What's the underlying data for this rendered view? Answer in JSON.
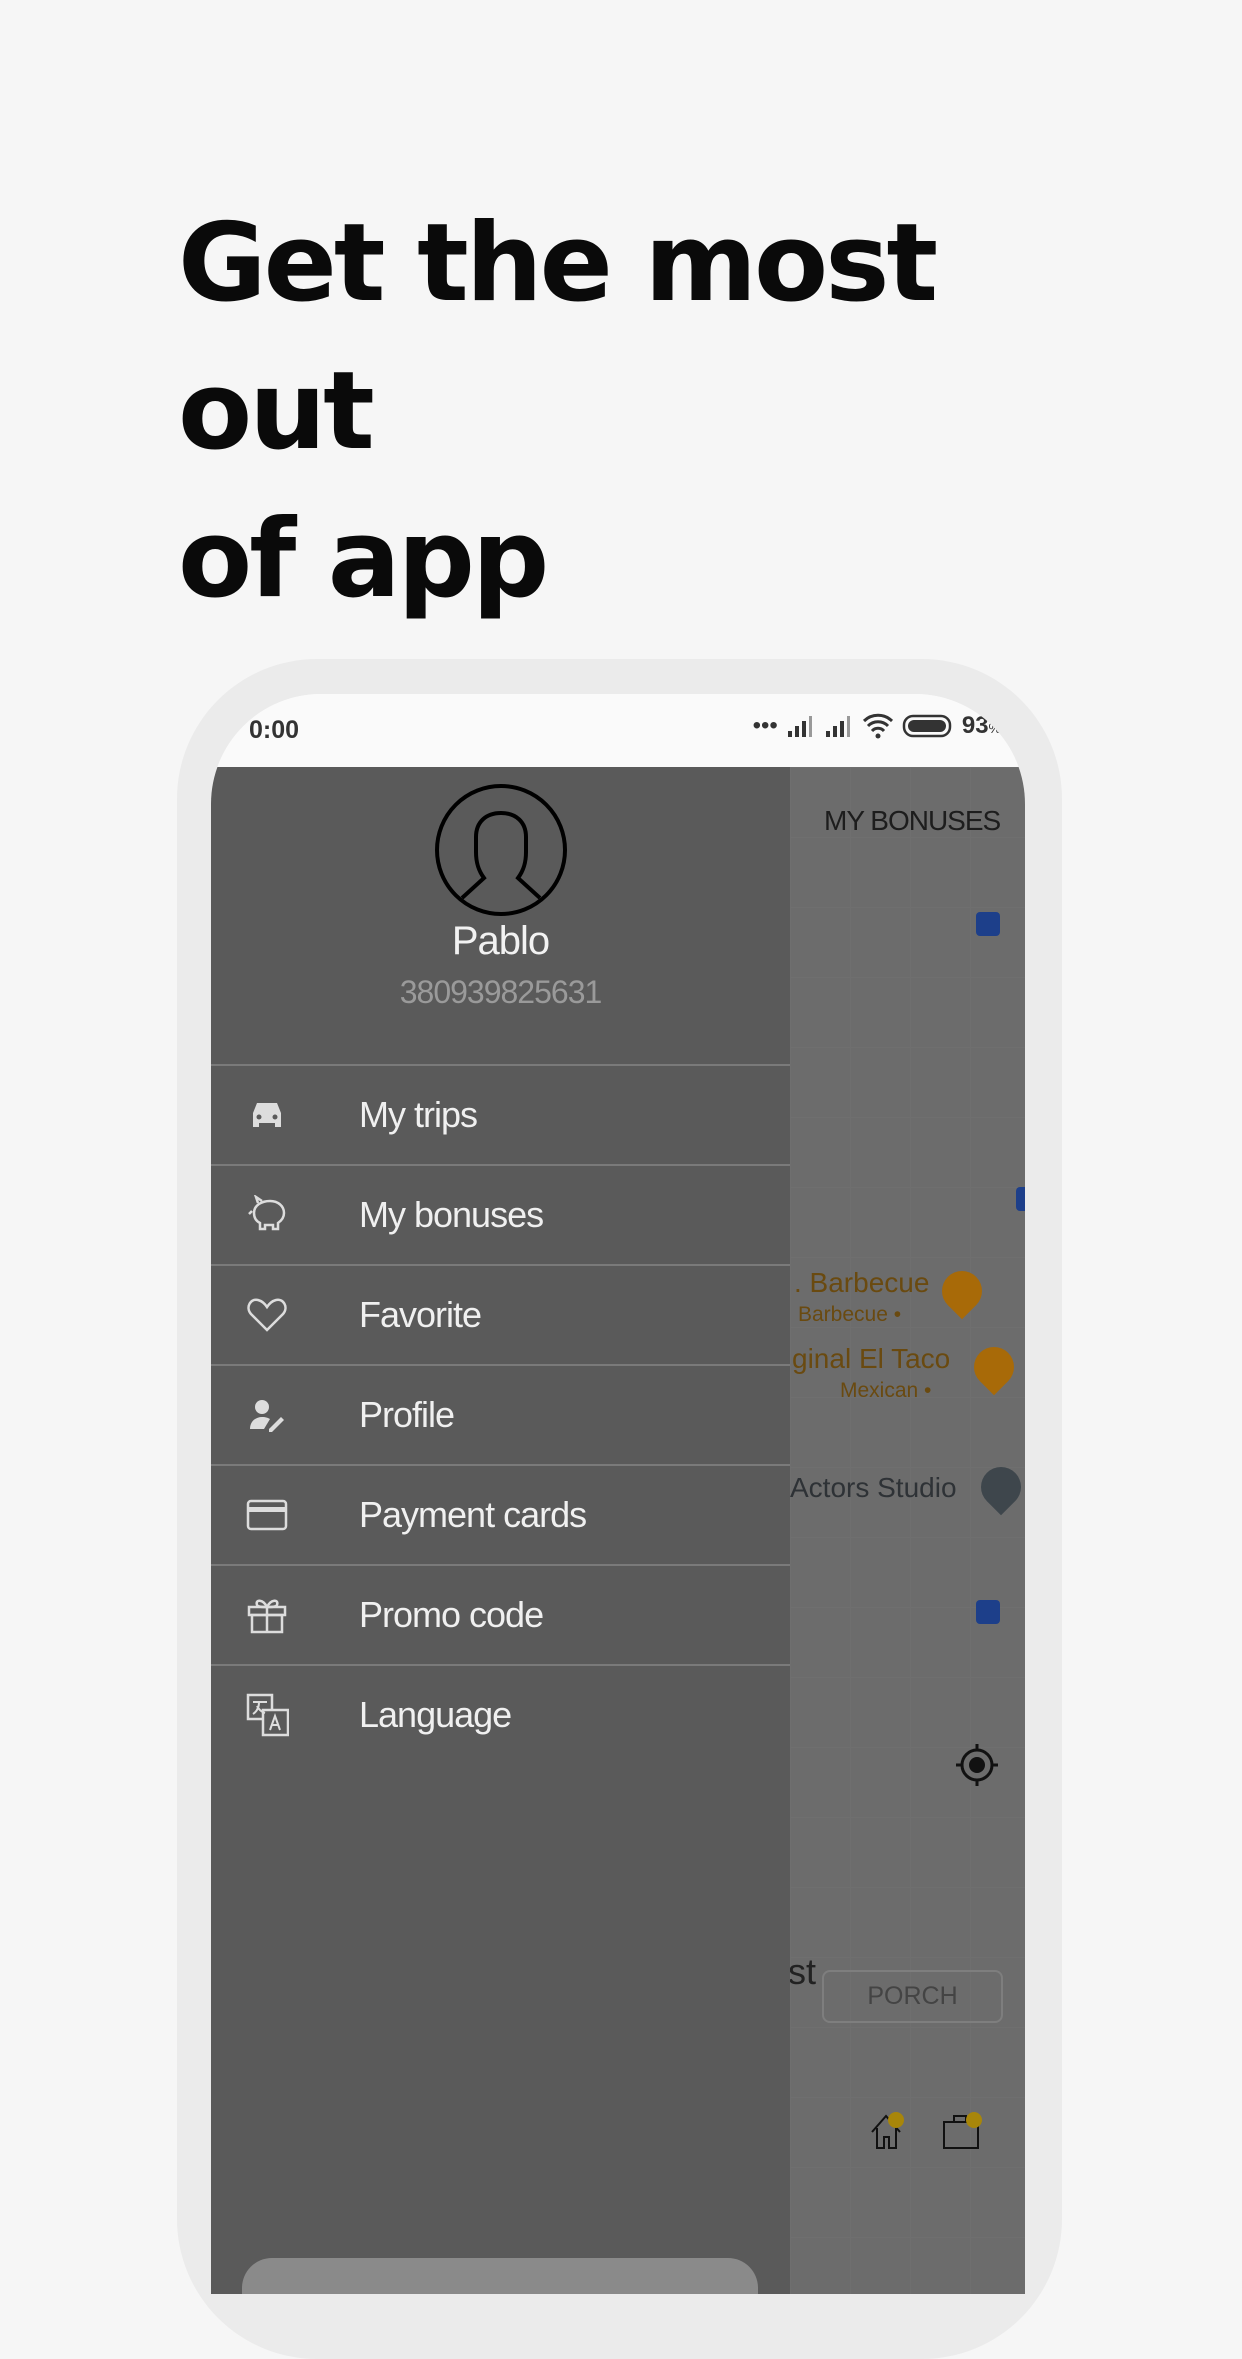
{
  "heading": {
    "line1": "Get the most out",
    "line2": "of app"
  },
  "status_bar": {
    "time": "0:00",
    "battery": "93",
    "battery_unit": "%"
  },
  "drawer": {
    "user_name": "Pablo",
    "phone": "380939825631",
    "items": [
      {
        "label": "My trips",
        "icon": "car-icon"
      },
      {
        "label": "My bonuses",
        "icon": "piggy-bank-icon"
      },
      {
        "label": "Favorite",
        "icon": "heart-icon"
      },
      {
        "label": "Profile",
        "icon": "user-edit-icon"
      },
      {
        "label": "Payment cards",
        "icon": "credit-card-icon"
      },
      {
        "label": "Promo code",
        "icon": "gift-icon"
      },
      {
        "label": "Language",
        "icon": "translate-icon"
      }
    ]
  },
  "map": {
    "header": "MY BONUSES",
    "places": [
      {
        "name": ". Barbecue",
        "category": "Barbecue •"
      },
      {
        "name": "ginal El Taco",
        "category": "Mexican •"
      },
      {
        "name": "Actors Studio"
      }
    ],
    "partial_text": "st",
    "porch_button": "PORCH"
  },
  "colors": {
    "drawer": "#5a5a5a",
    "pin": "#a86a08",
    "bus": "#1d3f8a"
  }
}
